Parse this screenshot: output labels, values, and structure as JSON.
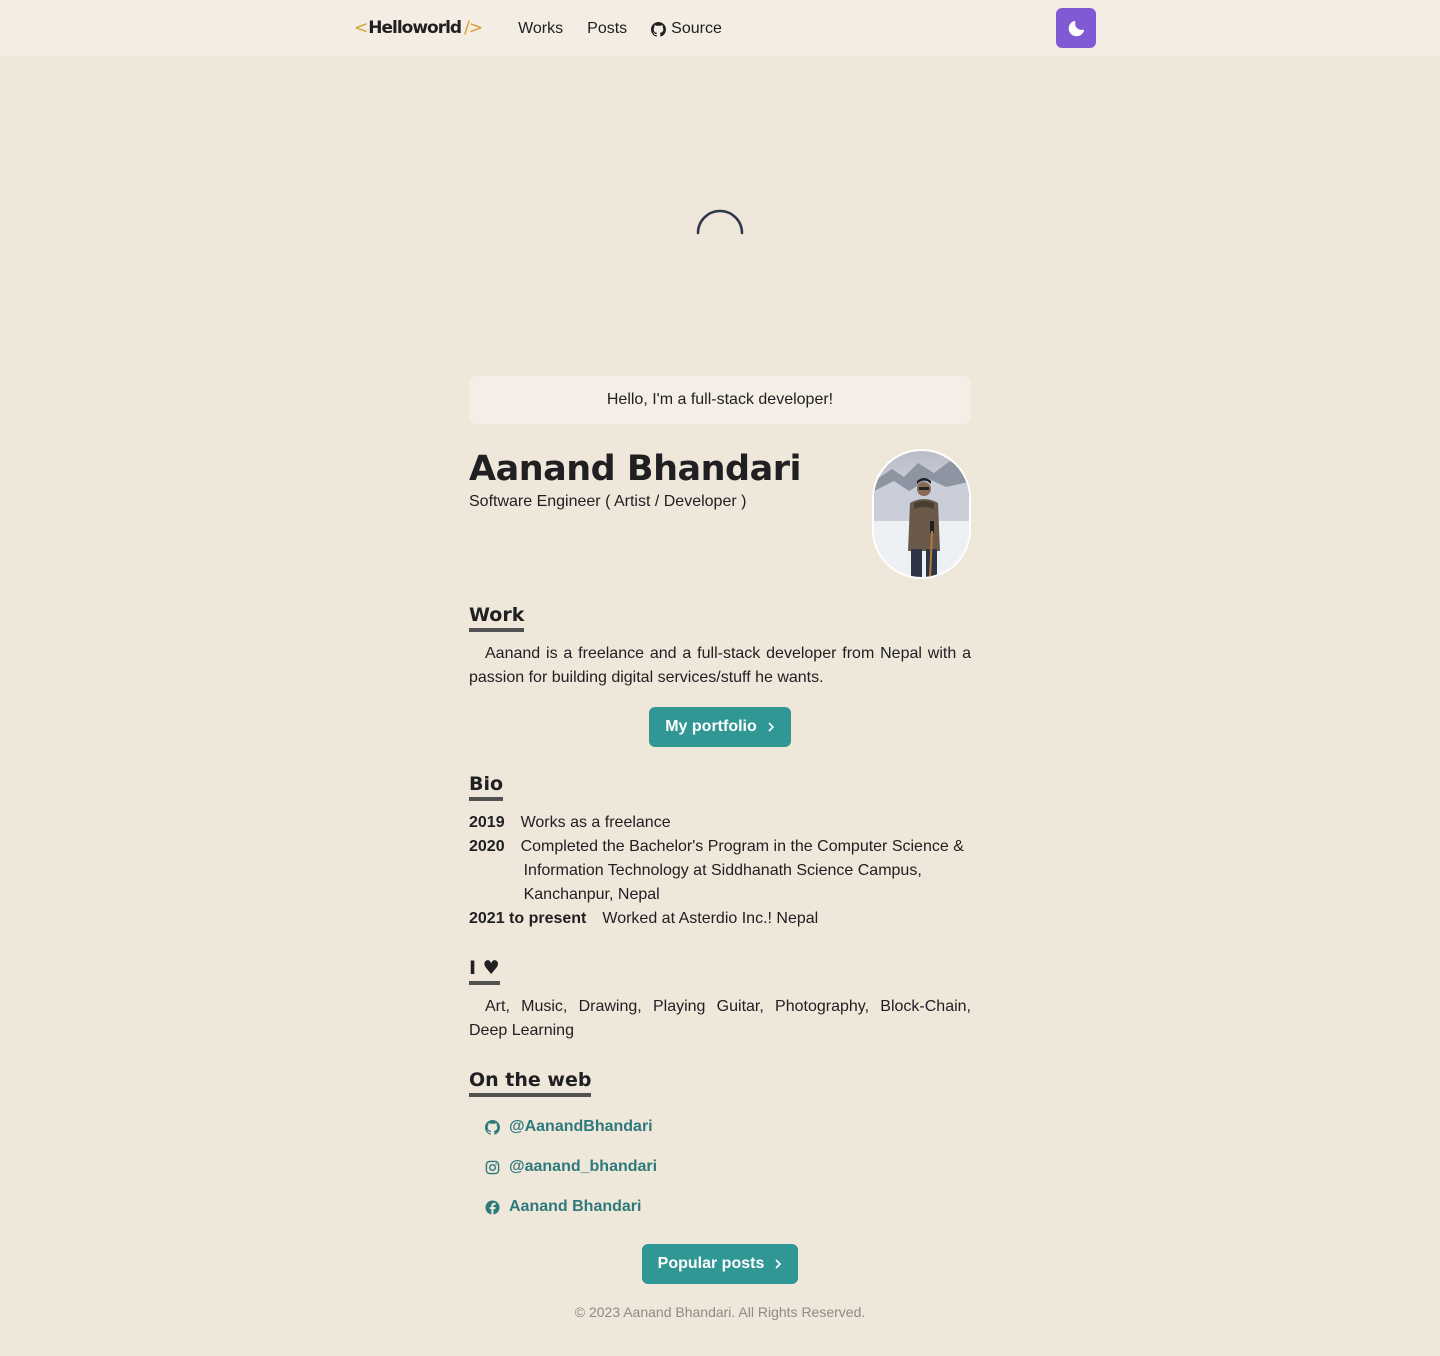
{
  "nav": {
    "logo_open": "<",
    "logo_word": "Helloworld",
    "logo_close": "/>",
    "links": [
      "Works",
      "Posts"
    ],
    "source_label": "Source",
    "theme_icon": "moon-icon"
  },
  "hero": {
    "greeting": "Hello, I'm a full-stack developer!",
    "name": "Aanand Bhandari",
    "role": "Software Engineer ( Artist / Developer )"
  },
  "work": {
    "heading": "Work",
    "text": "Aanand is a freelance and a full-stack developer from Nepal with a passion for building digital services/stuff he wants.",
    "button": "My portfolio"
  },
  "bio": {
    "heading": "Bio",
    "entries": [
      {
        "year": "2019",
        "text": "Works as a freelance"
      },
      {
        "year": "2020",
        "text": "Completed the Bachelor's Program in the Computer Science & Information Technology at Siddhanath Science Campus, Kanchanpur, Nepal"
      },
      {
        "year": "2021 to present",
        "text": "Worked at Asterdio Inc.! Nepal"
      }
    ]
  },
  "love": {
    "heading": "I ♥",
    "text": "Art, Music, Drawing, Playing Guitar, Photography, Block-Chain, Deep Learning"
  },
  "web": {
    "heading": "On the web",
    "items": [
      {
        "icon": "github-icon",
        "label": "@AanandBhandari"
      },
      {
        "icon": "instagram-icon",
        "label": "@aanand_bhandari"
      },
      {
        "icon": "facebook-icon",
        "label": "Aanand Bhandari"
      }
    ],
    "button": "Popular posts"
  },
  "footer": "© 2023 Aanand Bhandari. All Rights Reserved.",
  "colors": {
    "background": "#f0e7db",
    "accent": "#319795",
    "link": "#2c7a7b",
    "theme_button": "#805ad5",
    "logo_bracket": "#d69e2e"
  }
}
